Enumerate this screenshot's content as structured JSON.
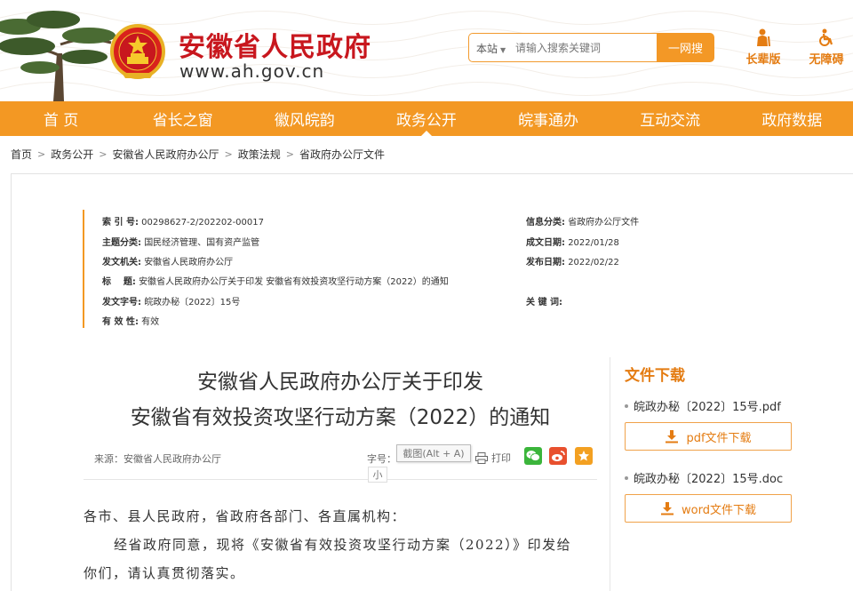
{
  "header": {
    "site_title": "安徽省人民政府",
    "site_url": "www.ah.gov.cn",
    "search": {
      "scope": "本站",
      "placeholder": "请输入搜索关键词",
      "button_label": "一网搜"
    },
    "tools": [
      {
        "label": "长辈版",
        "icon": "elder-icon"
      },
      {
        "label": "无障碍",
        "icon": "wheelchair-icon"
      }
    ],
    "colors": {
      "brand_red": "#c8171e",
      "accent_orange": "#f39823"
    }
  },
  "nav": {
    "items": [
      "首 页",
      "省长之窗",
      "徽风皖韵",
      "政务公开",
      "皖事通办",
      "互动交流",
      "政府数据"
    ],
    "active_index": 3
  },
  "breadcrumb": [
    "首页",
    "政务公开",
    "安徽省人民政府办公厅",
    "政策法规",
    "省政府办公厅文件"
  ],
  "info": {
    "index_label": "索 引 号:",
    "index_value": "00298627-2/202202-00017",
    "category_label": "信息分类:",
    "category_value": "省政府办公厅文件",
    "topic_label": "主题分类:",
    "topic_value": "国民经济管理、国有资产监管",
    "created_label": "成文日期:",
    "created_value": "2022/01/28",
    "issuer_label": "发文机关:",
    "issuer_value": "安徽省人民政府办公厅",
    "published_label": "发布日期:",
    "published_value": "2022/02/22",
    "title_label": "标    题:",
    "title_value": "安徽省人民政府办公厅关于印发 安徽省有效投资攻坚行动方案（2022）的通知",
    "docno_label": "发文字号:",
    "docno_value": "皖政办秘〔2022〕15号",
    "keywords_label": "关 键 词:",
    "keywords_value": "",
    "validity_label": "有 效 性:",
    "validity_value": "有效"
  },
  "article": {
    "title_line1": "安徽省人民政府办公厅关于印发",
    "title_line2": "安徽省有效投资攻坚行动方案（2022）的通知",
    "source": "来源：安徽省人民政府办公厅",
    "font_size_label": "字号：",
    "screenshot_tip": "截图(Alt + A)",
    "size_small": "小",
    "print_label": "打印",
    "share": [
      "wechat-icon",
      "weibo-icon",
      "favorite-icon"
    ],
    "paragraphs": [
      "各市、县人民政府，省政府各部门、各直属机构：",
      "经省政府同意，现将《安徽省有效投资攻坚行动方案（2022）》印发给",
      "你们，请认真贯彻落实。"
    ]
  },
  "downloads": {
    "title": "文件下载",
    "files": [
      {
        "name": "皖政办秘〔2022〕15号.pdf",
        "button": "pdf文件下载"
      },
      {
        "name": "皖政办秘〔2022〕15号.doc",
        "button": "word文件下载"
      }
    ]
  }
}
